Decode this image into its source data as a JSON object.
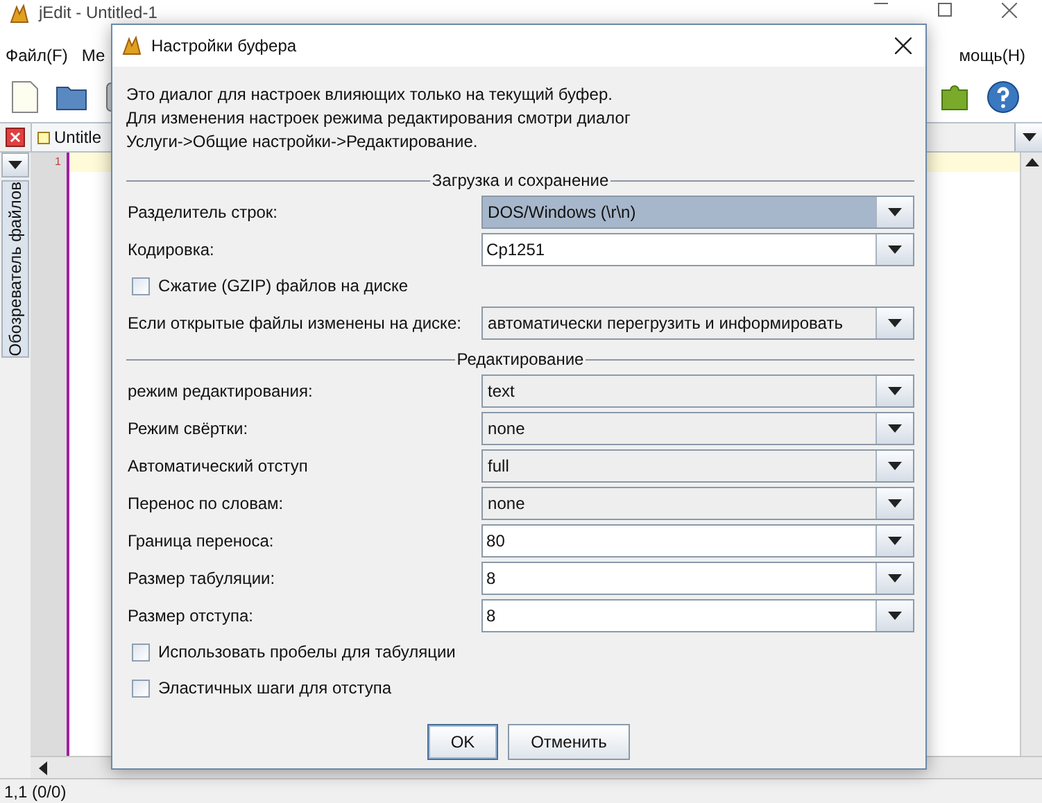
{
  "window": {
    "title": "jEdit - Untitled-1"
  },
  "menu": [
    {
      "label": "Файл(F)"
    },
    {
      "label": "Ме"
    },
    {
      "label": "мощь(H)"
    }
  ],
  "buffer_tab": {
    "label": "Untitle"
  },
  "gutter": {
    "line_number": "1"
  },
  "side_tab": {
    "label": "Обозреватель файлов"
  },
  "status_bar": {
    "position": "1,1 (0/0)"
  },
  "dialog": {
    "title": "Настройки буфера",
    "description": [
      "Это диалог для настроек влияющих только на текущий буфер.",
      "Для изменения настроек режима редактирования смотри диалог",
      "Услуги->Общие настройки->Редактирование."
    ],
    "sections": [
      {
        "title": "Загрузка и сохранение",
        "rows": [
          {
            "kind": "combo",
            "label": "Разделитель строк:",
            "value": "DOS/Windows (\\r\\n)",
            "editable": false,
            "focused": true
          },
          {
            "kind": "combo",
            "label": "Кодировка:",
            "value": "Cp1251",
            "editable": true,
            "focused": false
          },
          {
            "kind": "checkbox",
            "label": "Сжатие (GZIP) файлов на диске",
            "checked": false
          },
          {
            "kind": "combo",
            "label": "Если открытые файлы изменены на диске:",
            "value": "автоматически перегрузить и информировать",
            "editable": false,
            "focused": false
          }
        ]
      },
      {
        "title": "Редактирование",
        "rows": [
          {
            "kind": "combo",
            "label": "режим редактирования:",
            "value": "text",
            "editable": false,
            "focused": false
          },
          {
            "kind": "combo",
            "label": "Режим свёртки:",
            "value": "none",
            "editable": false,
            "focused": false
          },
          {
            "kind": "combo",
            "label": "Автоматический отступ",
            "value": "full",
            "editable": false,
            "focused": false
          },
          {
            "kind": "combo",
            "label": "Перенос по словам:",
            "value": "none",
            "editable": false,
            "focused": false
          },
          {
            "kind": "combo",
            "label": "Граница переноса:",
            "value": "80",
            "editable": true,
            "focused": false
          },
          {
            "kind": "combo",
            "label": "Размер табуляции:",
            "value": "8",
            "editable": true,
            "focused": false
          },
          {
            "kind": "combo",
            "label": "Размер отступа:",
            "value": "8",
            "editable": true,
            "focused": false
          },
          {
            "kind": "checkbox",
            "label": "Использовать пробелы для табуляции",
            "checked": false
          },
          {
            "kind": "checkbox",
            "label": "Эластичных шаги для отступа",
            "checked": false
          }
        ]
      }
    ],
    "buttons": [
      {
        "label": "OK",
        "default": true
      },
      {
        "label": "Отменить",
        "default": false
      }
    ]
  }
}
